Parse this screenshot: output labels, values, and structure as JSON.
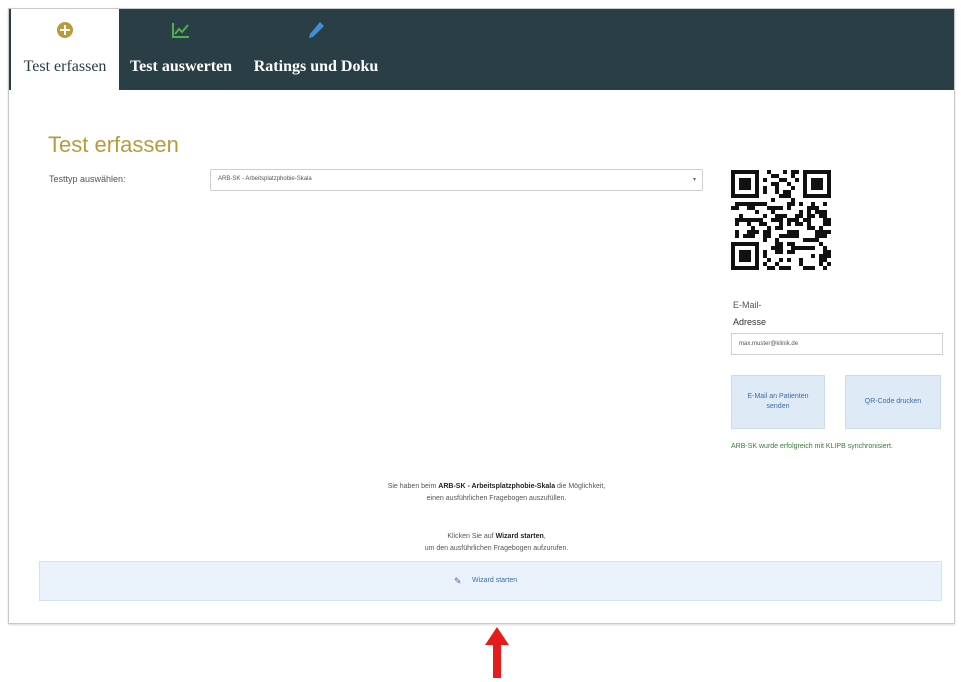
{
  "tabs": [
    {
      "label": "Test erfassen",
      "icon": "plus-circle-icon",
      "active": true
    },
    {
      "label": "Test auswerten",
      "icon": "chart-icon",
      "active": false
    },
    {
      "label": "Ratings und Doku",
      "icon": "pencil-icon",
      "active": false
    }
  ],
  "page_title": "Test erfassen",
  "testtyp": {
    "label": "Testtyp auswählen:",
    "selected": "ARB-SK - Arbeitsplatzphobie-Skala"
  },
  "email": {
    "label_line1": "E-Mail-",
    "label_line2": "Adresse",
    "value": "max.muster@klinik.de"
  },
  "buttons": {
    "send_mail": "E-Mail an Patienten senden",
    "qr_code": "QR-Code drucken"
  },
  "sync_status": "ARB-SK wurde erfolgreich mit KLIPB synchronisiert.",
  "info": {
    "line1_pre": "Sie haben beim ",
    "line1_bold": "ARB-SK - Arbeitsplatzphobie-Skala",
    "line1_post": " die Möglichkeit,",
    "line2": "einen ausführlichen Fragebogen auszufüllen.",
    "line3_pre": "Klicken Sie auf ",
    "line3_bold": "Wizard starten",
    "line3_post": ",",
    "line4": "um den ausführlichen Fragebogen aufzurufen."
  },
  "wizard_button": "Wizard starten",
  "colors": {
    "topbar": "#2a3e45",
    "title": "#b99b3c",
    "link_blue": "#3c6ea8",
    "success_green": "#3b7a3b",
    "annotation_arrow": "#e51c1c"
  }
}
